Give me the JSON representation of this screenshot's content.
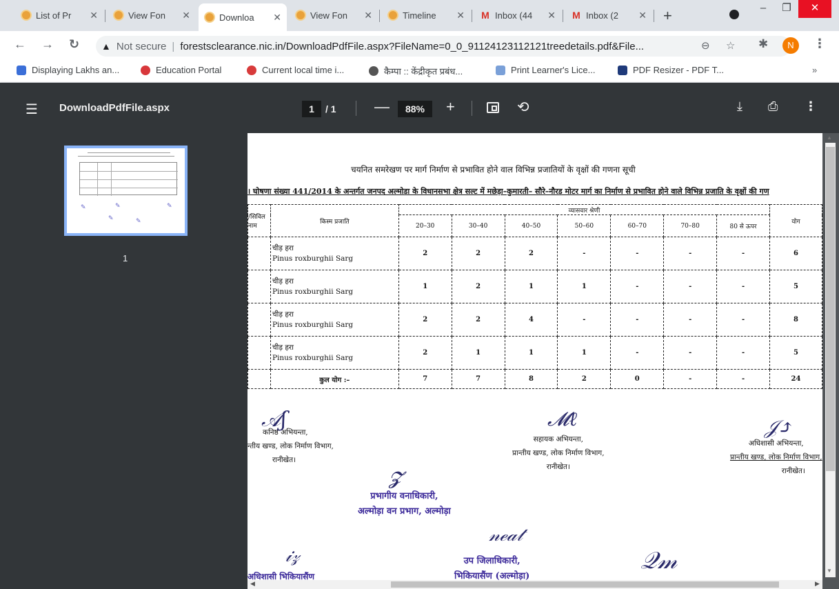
{
  "tabs": [
    {
      "title": "List of Pr",
      "favicon": "site-favicon",
      "active": false
    },
    {
      "title": "View Fon",
      "favicon": "site-favicon",
      "active": false
    },
    {
      "title": "Downloa",
      "favicon": "site-favicon",
      "active": true
    },
    {
      "title": "View Fon",
      "favicon": "site-favicon",
      "active": false
    },
    {
      "title": "Timeline",
      "favicon": "site-favicon",
      "active": false
    },
    {
      "title": "Inbox (44",
      "favicon": "gmail-icon",
      "active": false
    },
    {
      "title": "Inbox (2",
      "favicon": "gmail-icon",
      "active": false
    }
  ],
  "tab_close": "✕",
  "new_tab": "+",
  "window": {
    "minimize": "–",
    "restore": "❐",
    "close": "✕"
  },
  "address": {
    "security": "Not secure",
    "url": "forestsclearance.nic.in/DownloadPdfFile.aspx?FileName=0_0_91124123112121treedetails.pdf&File...",
    "profile_initial": "N"
  },
  "bookmarks": [
    {
      "label": "Displaying Lakhs an...",
      "color": "#3b6fd8"
    },
    {
      "label": "Education Portal",
      "color": "#d8373b"
    },
    {
      "label": "Current local time i...",
      "color": "#d83b3b"
    },
    {
      "label": "कैम्पा :: केंद्रीकृत प्रबंध...",
      "color": "#555555"
    },
    {
      "label": "Print Learner's Lice...",
      "color": "#7aa0d8"
    },
    {
      "label": "PDF Resizer - PDF T...",
      "color": "#1f3a7a"
    }
  ],
  "bookmarks_more": "»",
  "pdf_toolbar": {
    "title": "DownloadPdfFile.aspx",
    "page_current": "1",
    "page_total": "/ 1",
    "zoom": "88%"
  },
  "sidebar": {
    "page_label": "1"
  },
  "doc": {
    "title": "चयनित समरेखण पर मार्ग निर्माण से प्रभावित होने वाल विभिन्न प्रजातियों के वृक्षों की गणना सूची",
    "subtitle": "। घोषणा संख्या 441/2014 के अन्तर्गत जनपद अल्मोडा के विधानसभा क्षेत्र सल्ट में मछेड़ा–कुमारती– सौरे–नौरड मोटर मार्ग का निर्माण से प्रभावित होने वाले विभिन्न प्रजाति के वृक्षों की गण",
    "table": {
      "col_first": "/सिविल\nनाम",
      "col_species": "किस्म प्रजाति",
      "col_group": "व्यासवार श्रेणी",
      "col_total": "योग",
      "diameter_classes": [
        "20–30",
        "30–40",
        "40–50",
        "50–60",
        "60–70",
        "70–80",
        "80 से ऊपर"
      ],
      "rows": [
        {
          "local": "चीड़ हरा",
          "botanical": "Pinus roxburghii Sarg",
          "values": [
            "2",
            "2",
            "2",
            "-",
            "-",
            "-",
            "-"
          ],
          "total": "6"
        },
        {
          "local": "चीड़ हरा",
          "botanical": "Pinus roxburghii Sarg",
          "values": [
            "1",
            "2",
            "1",
            "1",
            "-",
            "-",
            "-"
          ],
          "total": "5"
        },
        {
          "local": "चीड़ हरा",
          "botanical": "Pinus roxburghii Sarg",
          "values": [
            "2",
            "2",
            "4",
            "-",
            "-",
            "-",
            "-"
          ],
          "total": "8"
        },
        {
          "local": "चीड़ हरा",
          "botanical": "Pinus roxburghii Sarg",
          "values": [
            "2",
            "1",
            "1",
            "1",
            "-",
            "-",
            "-"
          ],
          "total": "5"
        }
      ],
      "grand_label": "कुल योग :–",
      "grand_values": [
        "7",
        "7",
        "8",
        "2",
        "0",
        "-",
        "-"
      ],
      "grand_total": "24"
    },
    "signatories": {
      "junior": [
        "कनिष्ठ अभियन्ता,",
        "न्तीय खण्ड, लोक निर्माण विभाग,",
        "रानीखेत।"
      ],
      "assistant": [
        "सहायक अभियन्ता,",
        "प्रान्तीय खण्ड, लोक निर्माण विभाग,",
        "रानीखेत।"
      ],
      "executive": [
        "अधिशासी अभियन्ता,",
        "प्रान्तीय खण्ड, लोक निर्माण विभाग,",
        "रानीखेत।"
      ]
    },
    "stamp1": [
      "प्रभागीय वनाधिकारी,",
      "अल्मोड़ा वन प्रभाग, अल्मोड़ा"
    ],
    "stamp2": "उप जिलाधिकारी,",
    "stamp2b": "भिकियासैंण (अल्मोड़ा)",
    "stamp3": "अधिशासी भिकियासैंण"
  }
}
